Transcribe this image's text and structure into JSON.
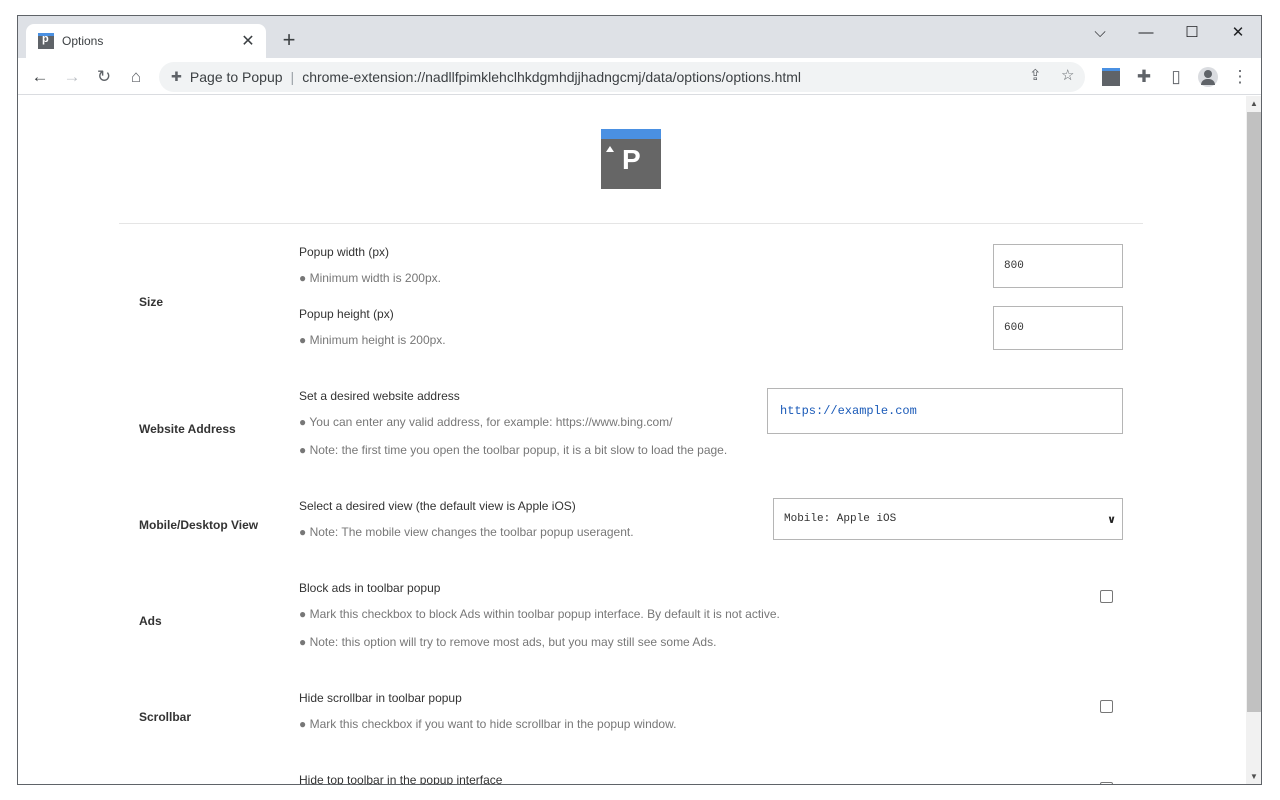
{
  "browser": {
    "tab_title": "Options",
    "new_tab_label": "+",
    "omnibox_ext_name": "Page to Popup",
    "omnibox_url": "chrome-extension://nadllfpimklehclhkdgmhdjjhadngcmj/data/options/options.html"
  },
  "page": {
    "size": {
      "label": "Size",
      "width_title": "Popup width (px)",
      "width_note": "● Minimum width is 200px.",
      "width_value": "800",
      "height_title": "Popup height (px)",
      "height_note": "● Minimum height is 200px.",
      "height_value": "600"
    },
    "website": {
      "label": "Website Address",
      "title": "Set a desired website address",
      "note1": "● You can enter any valid address, for example: https://www.bing.com/",
      "note2": "● Note: the first time you open the toolbar popup, it is a bit slow to load the page.",
      "value": "https://example.com"
    },
    "view": {
      "label": "Mobile/Desktop View",
      "title": "Select a desired view (the default view is Apple iOS)",
      "note": "● Note: The mobile view changes the toolbar popup useragent.",
      "selected": "Mobile: Apple iOS"
    },
    "ads": {
      "label": "Ads",
      "title": "Block ads in toolbar popup",
      "note1": "● Mark this checkbox to block Ads within toolbar popup interface. By default it is not active.",
      "note2": "● Note: this option will try to remove most ads, but you may still see some Ads.",
      "checked": false
    },
    "scrollbar": {
      "label": "Scrollbar",
      "title": "Hide scrollbar in toolbar popup",
      "note": "● Mark this checkbox if you want to hide scrollbar in the popup window.",
      "checked": false
    },
    "toolbar_row": {
      "title": "Hide top toolbar in the popup interface"
    }
  },
  "colors": {
    "accent": "#4a90e2",
    "logo_bg": "#666666",
    "url_text": "#1a5ab8"
  }
}
